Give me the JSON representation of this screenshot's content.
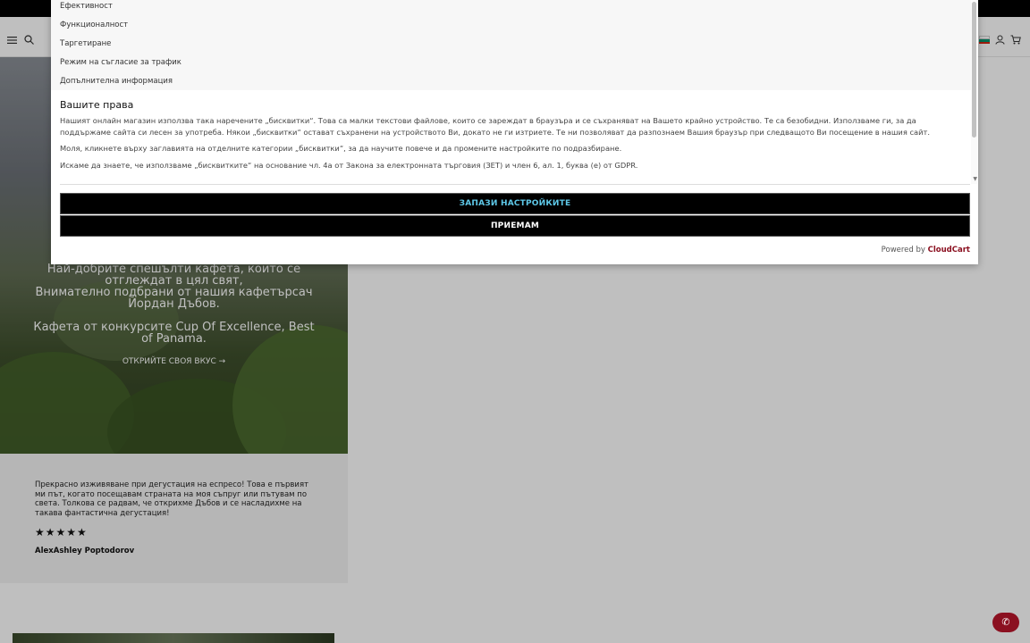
{
  "header": {
    "menu_icon": "hamburger-icon",
    "search_icon": "search-icon",
    "flag_colors": [
      "#ffffff",
      "#00966e",
      "#d62612"
    ],
    "user_icon": "user-icon",
    "cart_icon": "cart-icon"
  },
  "hero": {
    "line1": "Най-добрите спешълти кафета, които се",
    "line2": "отглеждат в цял свят,",
    "line3": "Внимателно подбрани от нашия кафетърсач",
    "line4": "Йордан Дъбов.",
    "line5": "Кафета от конкурсите Cup Of Excellence, Best",
    "line6": "of Panama.",
    "cta": "ОТКРИЙТЕ СВОЯ ВКУС →"
  },
  "review": {
    "text": "Прекрасно изживяване при дегустация на еспресо! Това е първият ми път, когато посещавам страната на моя съпруг или пътувам по света. Толкова се радвам, че открихме Дъбов и се насладихме на такава фантастична дегустация!",
    "stars": "★★★★★",
    "rating": 5,
    "author": "AlexAshley Poptodorov"
  },
  "cookie_modal": {
    "categories": [
      "Ефективност",
      "Функционалност",
      "Таргетиране",
      "Режим на съгласие за трафик",
      "Допълнителна информация"
    ],
    "rights_title": "Вашите права",
    "paragraph1": "Нашият онлайн магазин използва така наречените „бисквитки“. Това са малки текстови файлове, които се зареждат в браузъра и се съхраняват на Вашето крайно устройство. Те са безобидни. Използваме ги, за да поддържаме сайта си лесен за употреба. Някои „бисквитки“ остават съхранени на устройството Ви, докато не ги изтриете. Те ни позволяват да разпознаем Вашия браузър при следващото Ви посещение в нашия сайт.",
    "paragraph2": "Моля, кликнете върху заглавията на отделните категории „бисквитки“, за да научите повече и да промените настройките по подразбиране.",
    "paragraph3": "Искаме да знаете, че използваме „бисквитките“ на основание чл. 4а от Закона за електронната търговия (ЗЕТ) и член 6, ал. 1, буква (е) от GDPR.",
    "save_button": "ЗАПАЗИ НАСТРОЙКИТЕ",
    "accept_button": "ПРИЕМАМ",
    "powered_prefix": "Powered by",
    "powered_brand": "CloudCart"
  },
  "phone_icon": "phone-icon",
  "colors": {
    "accent": "#8b1020",
    "save_text": "#5ec8e8",
    "overlay": "rgba(0,0,0,0.25)"
  }
}
